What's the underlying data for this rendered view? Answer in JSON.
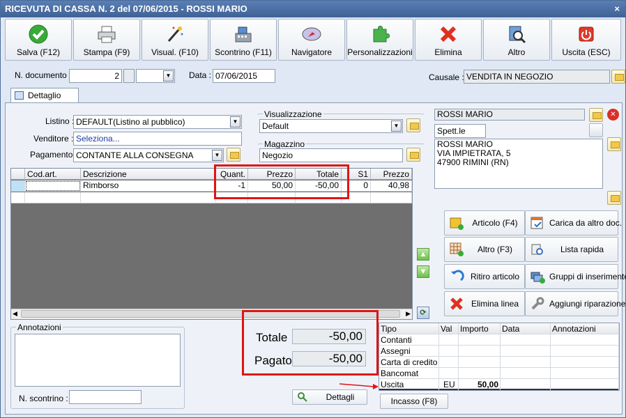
{
  "window": {
    "title": "RICEVUTA DI CASSA N. 2 del 07/06/2015 - ROSSI MARIO",
    "close": "×"
  },
  "toolbar": [
    {
      "label": "Salva (F12)",
      "icon": "check-icon"
    },
    {
      "label": "Stampa (F9)",
      "icon": "printer-icon"
    },
    {
      "label": "Visual. (F10)",
      "icon": "magic-wand-icon"
    },
    {
      "label": "Scontrino (F11)",
      "icon": "cash-register-icon"
    },
    {
      "label": "Navigatore",
      "icon": "compass-icon"
    },
    {
      "label": "Personalizzazioni",
      "icon": "puzzle-icon"
    },
    {
      "label": "Elimina",
      "icon": "delete-x-icon"
    },
    {
      "label": "Altro",
      "icon": "magnifier-icon"
    },
    {
      "label": "Uscita (ESC)",
      "icon": "power-icon"
    }
  ],
  "header": {
    "ndoc_label": "N. documento :",
    "ndoc_value": "2",
    "data_label": "Data :",
    "data_value": "07/06/2015",
    "causale_label": "Causale :",
    "causale_value": "VENDITA IN NEGOZIO"
  },
  "tab": {
    "label": "Dettaglio (F5)"
  },
  "form": {
    "listino_label": "Listino :",
    "listino_value": "DEFAULT(Listino al pubblico)",
    "venditore_label": "Venditore :",
    "venditore_value": "Seleziona...",
    "pagamento_label": "Pagamento :",
    "pagamento_value": "CONTANTE ALLA CONSEGNA",
    "visual_label": "Visualizzazione",
    "visual_value": "Default",
    "magazzino_label": "Magazzino",
    "magazzino_value": "Negozio"
  },
  "customer": {
    "name": "ROSSI MARIO",
    "title": "Spett.le",
    "address_lines": [
      "ROSSI MARIO",
      "VIA IMPIETRATA, 5",
      "47900 RIMINI (RN)"
    ]
  },
  "grid": {
    "headers": [
      "Cod.art.",
      "Descrizione",
      "Quant.",
      "Prezzo",
      "Totale",
      "S1",
      "Prezzo"
    ],
    "rows": [
      [
        "",
        "Rimborso",
        "-1",
        "50,00",
        "-50,00",
        "0",
        "40,98"
      ],
      [
        "",
        "",
        "",
        "",
        "",
        "",
        ""
      ]
    ]
  },
  "actions": [
    {
      "label": "Articolo (F4)",
      "icon": "box-add-icon"
    },
    {
      "label": "Carica da altro doc.",
      "icon": "document-check-icon"
    },
    {
      "label": "Altro (F3)",
      "icon": "grid-add-icon"
    },
    {
      "label": "Lista rapida",
      "icon": "list-search-icon"
    },
    {
      "label": "Ritiro articolo",
      "icon": "return-arrow-icon"
    },
    {
      "label": "Gruppi di inserimento",
      "icon": "group-add-icon"
    },
    {
      "label": "Elimina linea",
      "icon": "delete-x-icon"
    },
    {
      "label": "Aggiungi riparazione",
      "icon": "wrench-icon"
    }
  ],
  "notes": {
    "annotazioni_label": "Annotazioni",
    "scontrino_label": "N. scontrino :"
  },
  "totals": {
    "totale_label": "Totale",
    "totale_value": "-50,00",
    "pagato_label": "Pagato",
    "pagato_value": "-50,00",
    "dettagli_label": "Dettagli"
  },
  "payments": {
    "headers": [
      "Tipo",
      "Val",
      "Importo",
      "Data",
      "Annotazioni"
    ],
    "rows": [
      [
        "Contanti",
        "",
        "",
        "",
        ""
      ],
      [
        "Assegni",
        "",
        "",
        "",
        ""
      ],
      [
        "Carta di credito",
        "",
        "",
        "",
        ""
      ],
      [
        "Bancomat",
        "",
        "",
        "",
        ""
      ],
      [
        "Uscita",
        "EU",
        "50,00",
        "",
        ""
      ]
    ],
    "incasso_label": "Incasso (F8)"
  },
  "colors": {
    "title_bar": "#3f6296",
    "highlight_border": "#e01414",
    "panel": "#eef2f8"
  }
}
